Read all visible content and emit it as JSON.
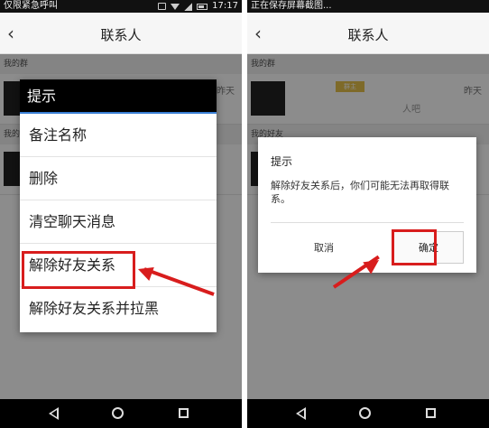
{
  "left": {
    "status": {
      "text": "仅限紧急呼叫",
      "time": "17:17"
    },
    "toolbar": {
      "back": "‹",
      "title": "联系人"
    },
    "section_groups": "我的群",
    "section_friends": "我的",
    "row1": {
      "time": "昨天"
    },
    "menu": {
      "title": "提示",
      "items": [
        "备注名称",
        "删除",
        "清空聊天消息",
        "解除好友关系",
        "解除好友关系并拉黑"
      ]
    }
  },
  "right": {
    "status": {
      "text": "正在保存屏幕截图..."
    },
    "toolbar": {
      "back": "‹",
      "title": "联系人"
    },
    "section_groups": "我的群",
    "section_friends": "我的好友",
    "row1": {
      "badge": "群主",
      "time": "昨天",
      "msg": "人吧"
    },
    "dialog": {
      "title": "提示",
      "message": "解除好友关系后，你们可能无法再取得联系。",
      "cancel": "取消",
      "ok": "确定"
    }
  },
  "colors": {
    "highlight": "#d81d1d",
    "menu_header": "#000000",
    "accent": "#3a7fd5"
  }
}
